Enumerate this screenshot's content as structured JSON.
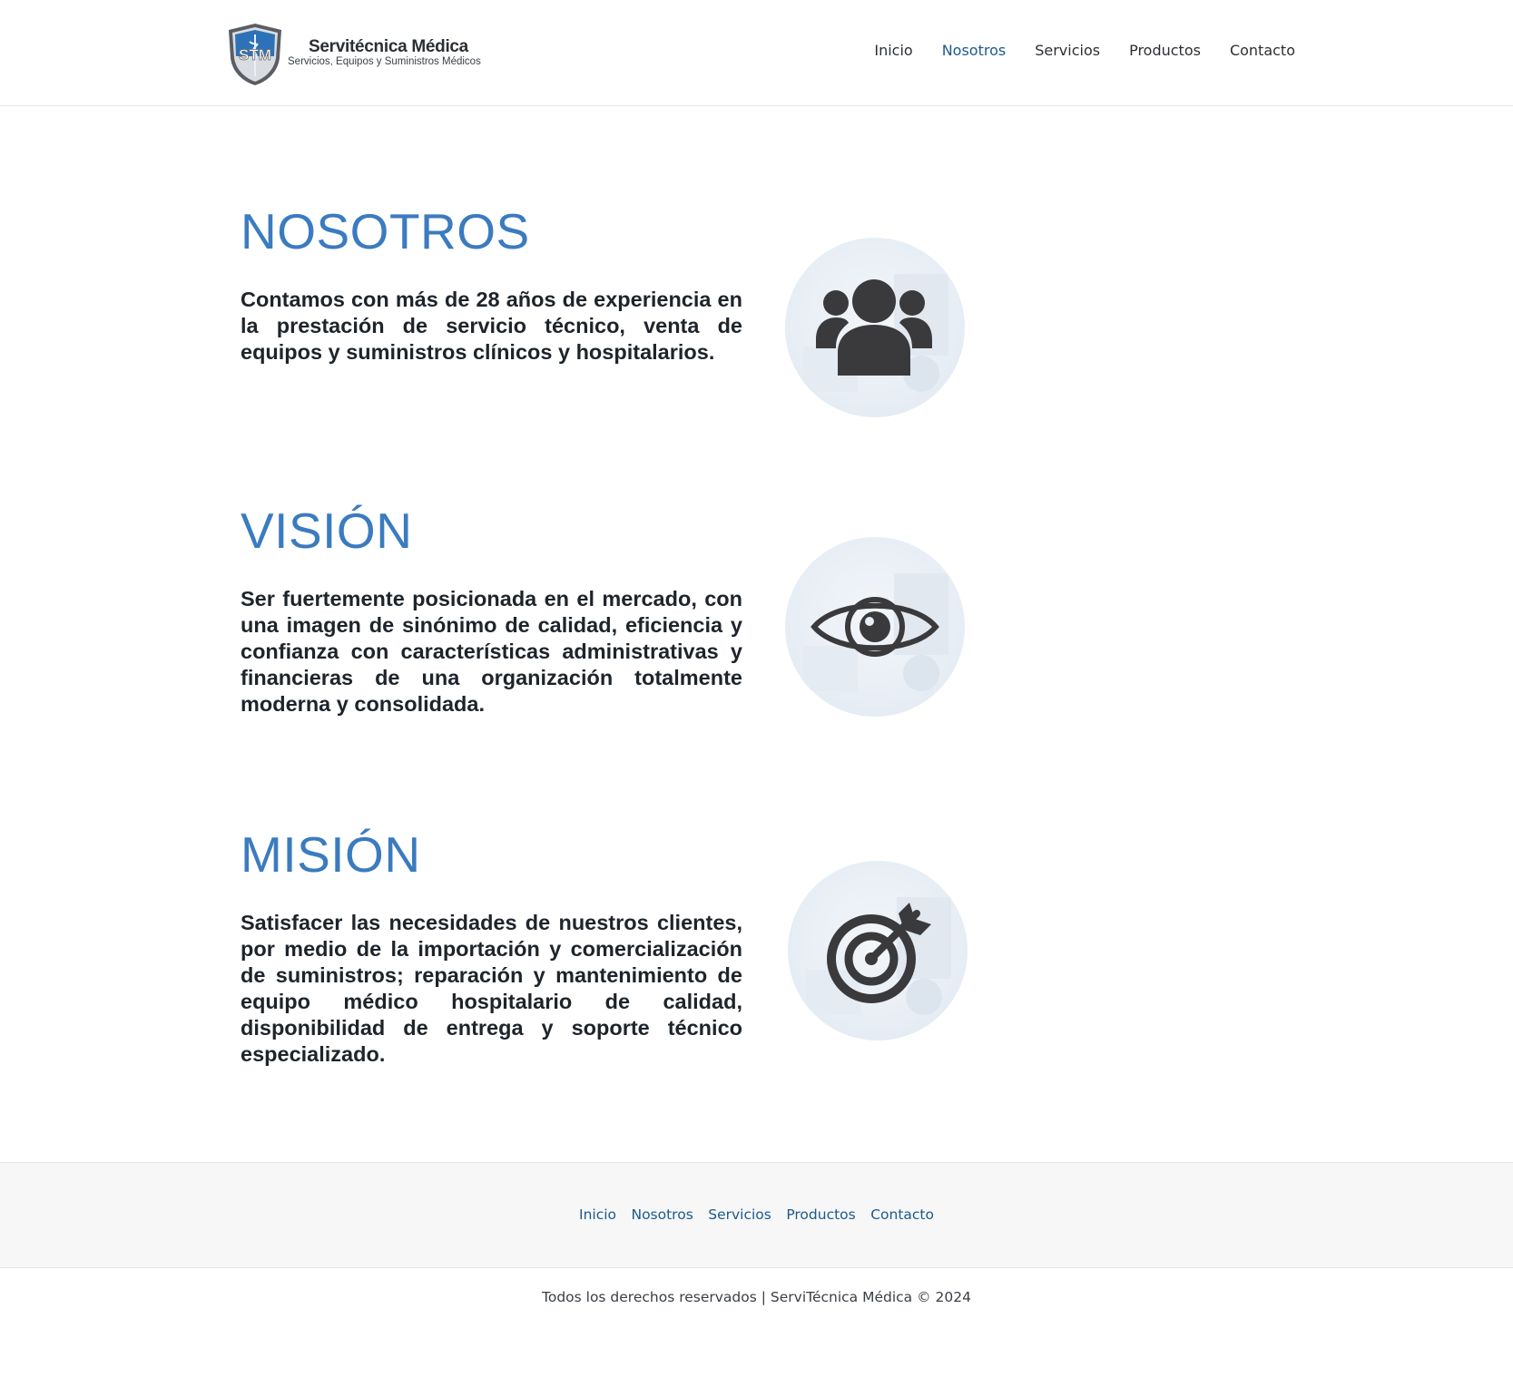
{
  "header": {
    "logo_initials": "STM",
    "logo_name": "Servitécnica Médica",
    "logo_tagline": "Servicios, Equipos y Suministros Médicos",
    "nav": [
      {
        "label": "Inicio",
        "active": false
      },
      {
        "label": "Nosotros",
        "active": true
      },
      {
        "label": "Servicios",
        "active": false
      },
      {
        "label": "Productos",
        "active": false
      },
      {
        "label": "Contacto",
        "active": false
      }
    ]
  },
  "sections": {
    "nosotros": {
      "title": "NOSOTROS",
      "text": "Contamos con más de 28 años de experiencia en la prestación de servicio técnico, venta de equipos y suministros clínicos y hospitalarios.",
      "icon": "users-icon"
    },
    "vision": {
      "title": "VISIÓN",
      "text": "Ser fuertemente posicionada en el mercado, con una imagen de sinónimo de calidad, eficiencia y confianza con características administrativas y financieras de una organización totalmente moderna y consolidada.",
      "icon": "eye-icon"
    },
    "mision": {
      "title": "MISIÓN",
      "text": "Satisfacer las necesidades de nuestros clientes, por medio de la importación y comercialización de suministros; reparación y mantenimiento de equipo médico hospitalario de calidad, disponibilidad de entrega y soporte técnico especializado.",
      "icon": "target-icon"
    }
  },
  "footer": {
    "nav": [
      {
        "label": "Inicio"
      },
      {
        "label": "Nosotros"
      },
      {
        "label": "Servicios"
      },
      {
        "label": "Productos"
      },
      {
        "label": "Contacto"
      }
    ],
    "copyright": "Todos los derechos reservados | ServiTécnica Médica © 2024"
  },
  "colors": {
    "accent_title": "#3b7bbf",
    "nav_active": "#1c5a8c",
    "icon_dark": "#3a3a3c"
  }
}
